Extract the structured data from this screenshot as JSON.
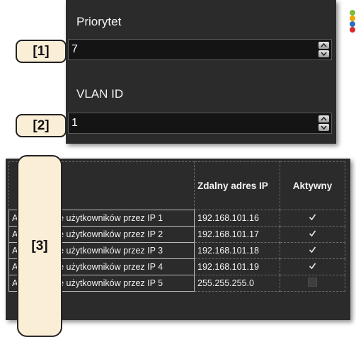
{
  "priority": {
    "label": "Priorytet",
    "value": "7"
  },
  "vlan": {
    "label": "VLAN ID",
    "value": "1"
  },
  "tags": {
    "t1": "[1]",
    "t2": "[2]",
    "t3": "[3]"
  },
  "table": {
    "headers": {
      "remote_ip": "Zdalny adres IP",
      "active": "Aktywny"
    },
    "rows": [
      {
        "prefix": "A",
        "name": "nie użytkowników przez IP 1",
        "ip": "192.168.101.16",
        "active": true
      },
      {
        "prefix": "A",
        "name": "nie użytkowników przez IP 2",
        "ip": "192.168.101.17",
        "active": true
      },
      {
        "prefix": "A",
        "name": "nie użytkowników przez IP 3",
        "ip": "192.168.101.18",
        "active": true
      },
      {
        "prefix": "A",
        "name": "nie użytkowników przez IP 4",
        "ip": "192.168.101.19",
        "active": true
      },
      {
        "prefix": "A",
        "name": "nie użytkowników przez IP 5",
        "ip": "255.255.255.0",
        "active": false
      }
    ]
  },
  "colors": {
    "panel_bg": "#2b2b2b",
    "tag_bg": "#fbeed7",
    "dots": [
      "#7dbb3a",
      "#f2a400",
      "#2c6fc0",
      "#d7282d"
    ]
  }
}
